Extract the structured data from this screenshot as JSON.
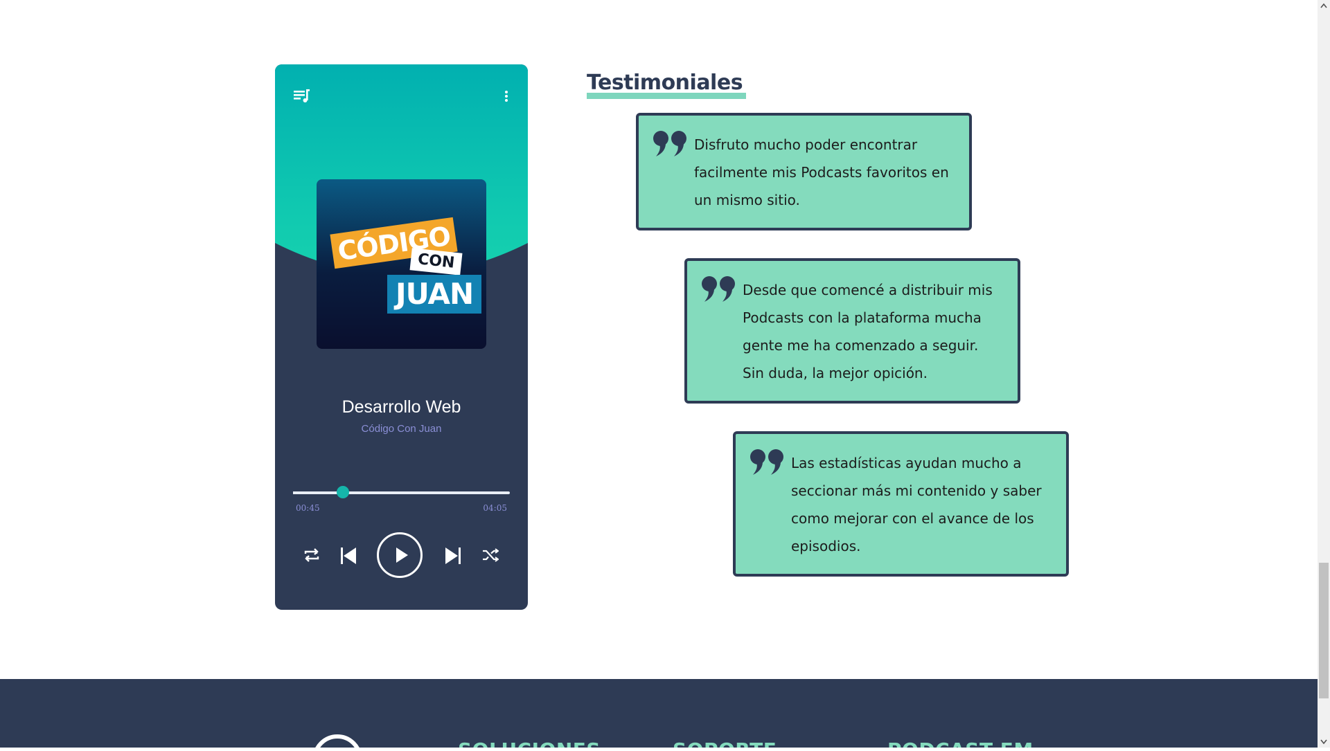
{
  "player": {
    "icons": {
      "playlist": "playlist-icon",
      "more": "more-vertical-icon",
      "repeat": "repeat-icon",
      "previous": "skip-previous-icon",
      "play": "play-icon",
      "next": "skip-next-icon",
      "shuffle": "shuffle-icon"
    },
    "cover": {
      "word1": "CÓDIGO",
      "word2": "CON",
      "word3": "JUAN"
    },
    "track_title": "Desarrollo Web",
    "track_artist": "Código Con Juan",
    "current_time": "00:45",
    "total_time": "04:05",
    "progress_fraction": 0.23,
    "colors": {
      "accent": "#15b5aa",
      "dark": "#2e3b55",
      "artist_text": "#8b8fd6"
    }
  },
  "testimonials": {
    "title": "Testimoniales",
    "items": [
      {
        "text": "Disfruto mucho poder encontrar facilmente mis Podcasts favoritos en un mismo sitio."
      },
      {
        "text": "Desde que comencé a distribuir mis Podcasts con la plataforma mucha gente me ha comenzado a seguir. Sin duda, la mejor opición."
      },
      {
        "text": "Las estadísticas ayudan mucho a seccionar más mi contenido y saber como mejorar con el avance de los episodios."
      }
    ],
    "colors": {
      "card_bg": "#84dbbd",
      "card_border": "#2e3b55"
    }
  },
  "footer": {
    "columns": [
      "SOLUCIONES",
      "SOPORTE",
      "PODCAST FM"
    ],
    "colors": {
      "bg": "#2e3b55",
      "heading": "#84dbbd"
    }
  }
}
